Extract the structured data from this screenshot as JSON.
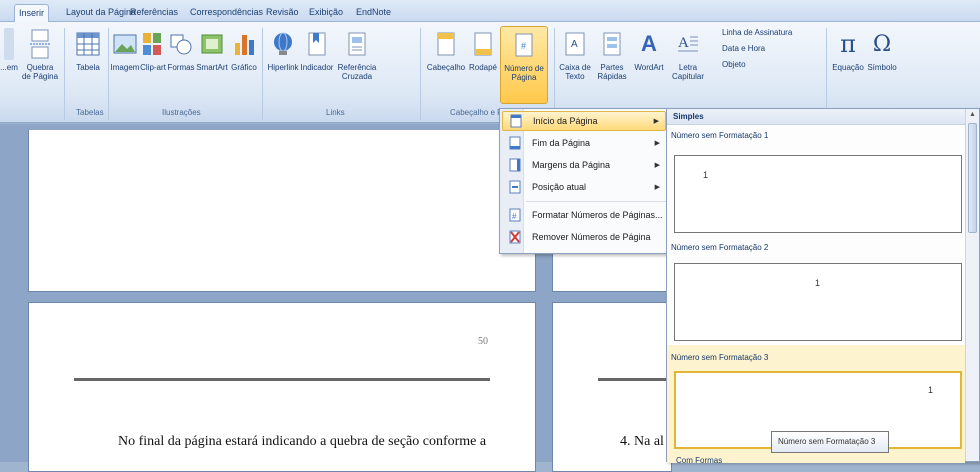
{
  "tabs": [
    "Inserir",
    "Layout da Página",
    "Referências",
    "Correspondências",
    "Revisão",
    "Exibição",
    "EndNote"
  ],
  "ribbon": {
    "buttons": [
      {
        "label": "...em",
        "icon": "page-icon"
      },
      {
        "label": "Quebra\nde Página",
        "icon": "page-break-icon"
      },
      {
        "label": "Tabela",
        "icon": "table-icon"
      },
      {
        "label": "Imagem",
        "icon": "picture-icon"
      },
      {
        "label": "Clip-art",
        "icon": "clipart-icon"
      },
      {
        "label": "Formas",
        "icon": "shapes-icon"
      },
      {
        "label": "SmartArt",
        "icon": "smartart-icon"
      },
      {
        "label": "Gráfico",
        "icon": "chart-icon"
      },
      {
        "label": "Hiperlink",
        "icon": "hyperlink-icon"
      },
      {
        "label": "Indicador",
        "icon": "bookmark-icon"
      },
      {
        "label": "Referência\nCruzada",
        "icon": "cross-reference-icon"
      },
      {
        "label": "Cabeçalho",
        "icon": "header-icon"
      },
      {
        "label": "Rodapé",
        "icon": "footer-icon"
      },
      {
        "label": "Número de\nPágina",
        "icon": "page-number-icon"
      },
      {
        "label": "Caixa de\nTexto",
        "icon": "textbox-icon"
      },
      {
        "label": "Partes\nRápidas",
        "icon": "quick-parts-icon"
      },
      {
        "label": "WordArt",
        "icon": "wordart-icon"
      },
      {
        "label": "Letra\nCapitular",
        "icon": "dropcap-icon"
      },
      {
        "label": "Equação",
        "icon": "equation-icon"
      },
      {
        "label": "Símbolo",
        "icon": "symbol-icon"
      }
    ],
    "small_buttons": [
      "Linha de Assinatura",
      "Data e Hora",
      "Objeto"
    ],
    "groups": [
      "Tabelas",
      "Ilustrações",
      "Links",
      "Cabeçalho e R..."
    ]
  },
  "menu": {
    "items": [
      {
        "label": "Início da Página",
        "has_submenu": true
      },
      {
        "label": "Fim da Página",
        "has_submenu": true
      },
      {
        "label": "Margens da Página",
        "has_submenu": true
      },
      {
        "label": "Posição atual",
        "has_submenu": true
      },
      {
        "label": "Formatar Números de Páginas...",
        "has_submenu": false
      },
      {
        "label": "Remover Números de Página",
        "has_submenu": false
      }
    ]
  },
  "gallery": {
    "header": "Simples",
    "items": [
      {
        "title": "Número sem Formatação 1",
        "align": "left"
      },
      {
        "title": "Número sem Formatação 2",
        "align": "center"
      },
      {
        "title": "Número sem Formatação 3",
        "align": "right"
      }
    ],
    "tooltip": "Número sem Formatação 3",
    "bottom_label": "Com Formas"
  },
  "document": {
    "page_number": "50",
    "body_text": "No final da página estará indicando a quebra de seção conforme a",
    "body_text_right": "4.  Na al"
  }
}
